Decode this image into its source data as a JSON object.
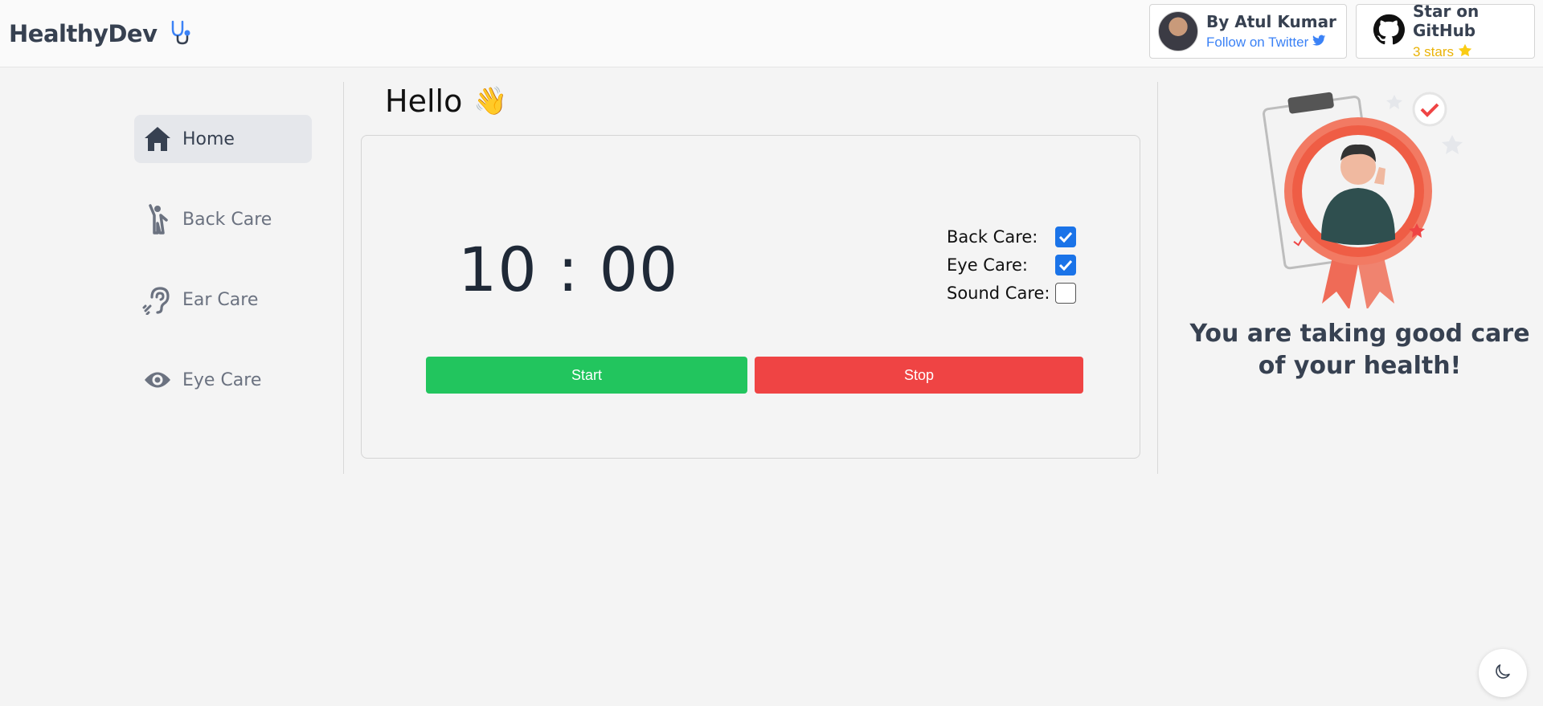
{
  "brand": {
    "name": "HealthyDev",
    "icon": "stethoscope-icon"
  },
  "author_card": {
    "title": "By Atul Kumar",
    "subtitle": "Follow on Twitter",
    "icon": "twitter-icon"
  },
  "github_card": {
    "title": "Star on GitHub",
    "subtitle": "3 stars",
    "icon": "github-icon",
    "star_icon": "star-icon"
  },
  "sidebar": {
    "items": [
      {
        "label": "Home",
        "icon": "home-icon",
        "active": true
      },
      {
        "label": "Back Care",
        "icon": "person-stretch-icon",
        "active": false
      },
      {
        "label": "Ear Care",
        "icon": "ear-icon",
        "active": false
      },
      {
        "label": "Eye Care",
        "icon": "eye-icon",
        "active": false
      }
    ]
  },
  "main": {
    "greeting": "Hello",
    "greeting_emoji": "👋",
    "timer": "10 : 00",
    "options": [
      {
        "label": "Back Care:",
        "checked": true
      },
      {
        "label": "Eye Care:",
        "checked": true
      },
      {
        "label": "Sound Care:",
        "checked": false
      }
    ],
    "start_label": "Start",
    "stop_label": "Stop"
  },
  "right": {
    "message": "You are taking good care of your health!"
  },
  "colors": {
    "start": "#22c55e",
    "stop": "#ef4444",
    "link": "#3b82f6",
    "star": "#eab308",
    "checkbox": "#1a73e8"
  },
  "dark_toggle": {
    "icon": "moon-icon"
  }
}
